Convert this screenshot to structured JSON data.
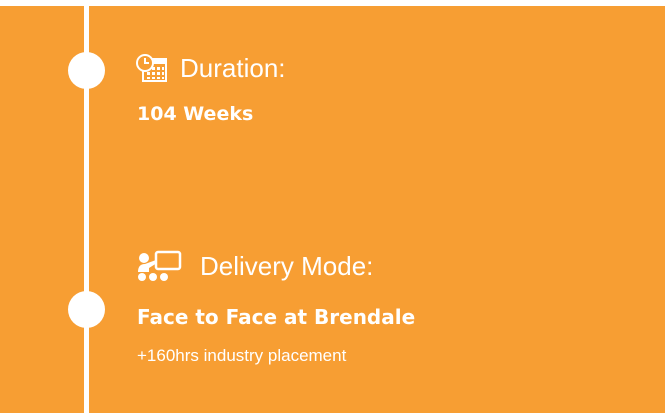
{
  "colors": {
    "panel_background": "#f79e33",
    "text": "#ffffff",
    "timeline": "#ffffff"
  },
  "duration": {
    "icon": "calendar-clock-icon",
    "label": "Duration:",
    "value": "104 Weeks"
  },
  "delivery": {
    "icon": "classroom-presentation-icon",
    "label": "Delivery Mode:",
    "value": "Face to Face at Brendale",
    "note": "+160hrs industry placement"
  }
}
